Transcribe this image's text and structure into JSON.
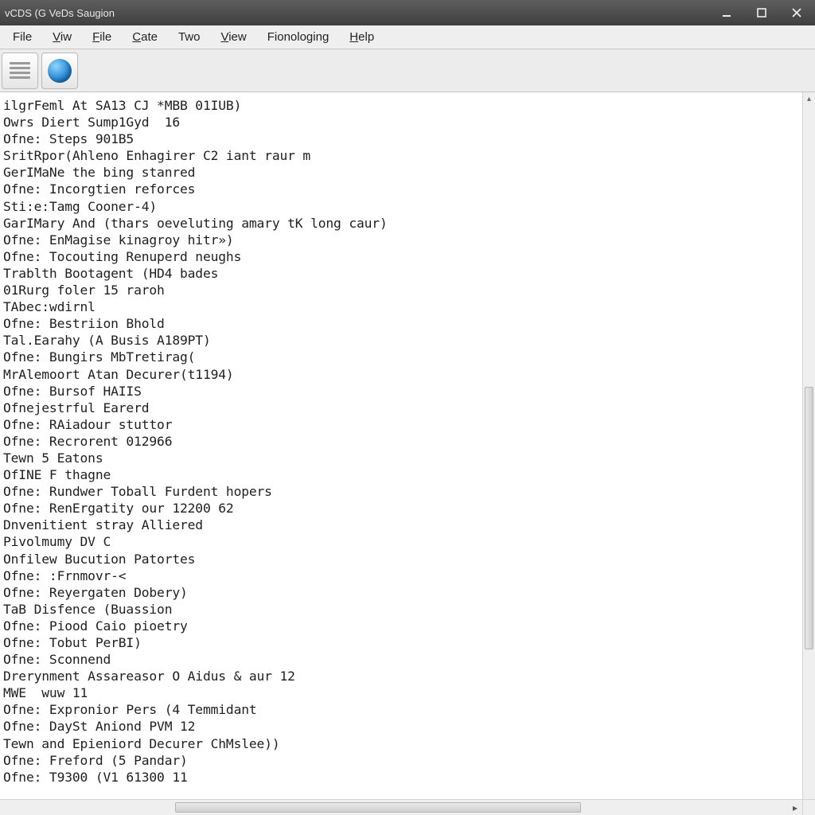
{
  "window": {
    "title": "vCDS (G VeDs Saugion"
  },
  "menu": {
    "items": [
      {
        "label": "File",
        "underline_first": false
      },
      {
        "label": "Viw",
        "underline_first": true
      },
      {
        "label": "File",
        "underline_first": true
      },
      {
        "label": "Cate",
        "underline_first": true
      },
      {
        "label": "Two",
        "underline_first": false
      },
      {
        "label": "View",
        "underline_first": true
      },
      {
        "label": "Fionologing",
        "underline_first": false
      },
      {
        "label": "Help",
        "underline_first": true
      }
    ]
  },
  "log_lines": [
    "ilgrFeml At SA13 CJ *MBB 01IUB)",
    "Owrs Diert Sump1Gyd  16",
    "Ofne: Steps 901B5",
    "SritRpor(Ahleno Enhagirer C2 iant raur m",
    "GerIMaNe the bing stanred",
    "Ofne: Incorgtien reforces",
    "Sti:e:Tamg Cooner-4)",
    "GarIMary And (thars oeveluting amary tK long caur)",
    "Ofne: EnMagise kinagroy hitr»)",
    "Ofne: Tocouting Renuperd neughs",
    "Trablth Bootagent (HD4 bades",
    "01Rurg foler 15 raroh",
    "TAbec:wdirnl",
    "Ofne: Bestriion Bhold",
    "Tal.Earahy (A Busis A189PT)",
    "Ofne: Bungirs MbTretirag(",
    "MrAlemoort Atan Decurer(t1194)",
    "Ofne: Bursof HAIIS",
    "Ofnejestrful Earerd",
    "Ofne: RAiadour stuttor",
    "Ofne: Recrorent 012966",
    "Tewn 5 Eatons",
    "OfINE F thagne",
    "Ofne: Rundwer Toball Furdent hopers",
    "Ofne: RenErgatity our 12200 62",
    "Dnvenitient stray Alliered",
    "Pivolmumy DV C",
    "Onfilew Bucution Patortes",
    "Ofne: :Frnmovr-<",
    "Ofne: Reyergaten Dobery)",
    "TaB Disfence (Buassion",
    "Ofne: Piood Caio pioetry",
    "Ofne: Tobut PerBI)",
    "Ofne: Sconnend",
    "Drerynment Assareasor O Aidus & aur 12",
    "MWE  wuw 11",
    "Ofne: Expronior Pers (4 Temmidant",
    "Ofne: DaySt Aniond PVM 12",
    "Tewn and Epieniord Decurer ChMslee))",
    "Ofne: Freford (5 Pandar)",
    "Ofne: T9300 (V1 61300 11"
  ]
}
